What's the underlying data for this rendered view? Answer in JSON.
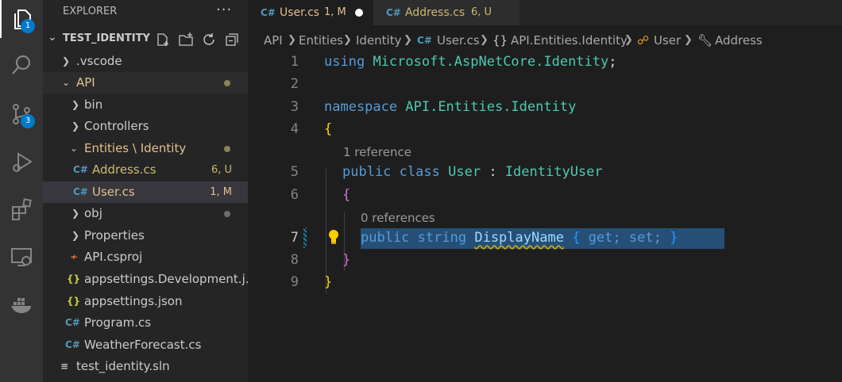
{
  "activity_bar": {
    "explorer_badge": "1",
    "scm_badge": "3",
    "icons": [
      "files-icon",
      "search-icon",
      "source-control-icon",
      "run-debug-icon",
      "extensions-icon",
      "remote-explorer-icon",
      "docker-icon"
    ]
  },
  "explorer": {
    "title": "EXPLORER",
    "more": "···",
    "project": "TEST_IDENTITY",
    "tree": [
      {
        "label": ".vscode"
      },
      {
        "label": "API"
      },
      {
        "label": "bin"
      },
      {
        "label": "Controllers"
      },
      {
        "label": "Entities \\ Identity"
      },
      {
        "label": "Address.cs",
        "status": "6, U"
      },
      {
        "label": "User.cs",
        "status": "1, M"
      },
      {
        "label": "obj"
      },
      {
        "label": "Properties"
      },
      {
        "label": "API.csproj"
      },
      {
        "label": "appsettings.Development.j..."
      },
      {
        "label": "appsettings.json"
      },
      {
        "label": "Program.cs"
      },
      {
        "label": "WeatherForecast.cs"
      },
      {
        "label": "test_identity.sln"
      }
    ]
  },
  "tabs": [
    {
      "label": "User.cs",
      "status": "1, M"
    },
    {
      "label": "Address.cs",
      "status": "6, U"
    }
  ],
  "breadcrumb": [
    "API",
    "Entities",
    "Identity",
    "User.cs",
    "API.Entities.Identity",
    "User",
    "Address"
  ],
  "editor": {
    "line_numbers": [
      "1",
      "2",
      "3",
      "4",
      "5",
      "6",
      "7",
      "8",
      "9"
    ],
    "code": {
      "l1_kw": "using",
      "l1_ns": "Microsoft.AspNetCore.Identity",
      "l1_end": ";",
      "l3_kw": "namespace",
      "l3_ns": "API.Entities.Identity",
      "l4": "{",
      "lens1": "1 reference",
      "l5_kw1": "public",
      "l5_kw2": "class",
      "l5_name": "User",
      "l5_colon": ":",
      "l5_base": "IdentityUser",
      "l6": "{",
      "lens2": "0 references",
      "l7_kw1": "public",
      "l7_kw2": "string",
      "l7_prop": "DisplayName",
      "l7_open": "{",
      "l7_get": "get;",
      "l7_set": "set;",
      "l7_close": "}",
      "l8": "}",
      "l9": "}"
    }
  },
  "colors": {
    "accent": "#007acc",
    "modified": "#e2c08d",
    "keyword": "#569cd6",
    "type": "#4ec9b0"
  }
}
